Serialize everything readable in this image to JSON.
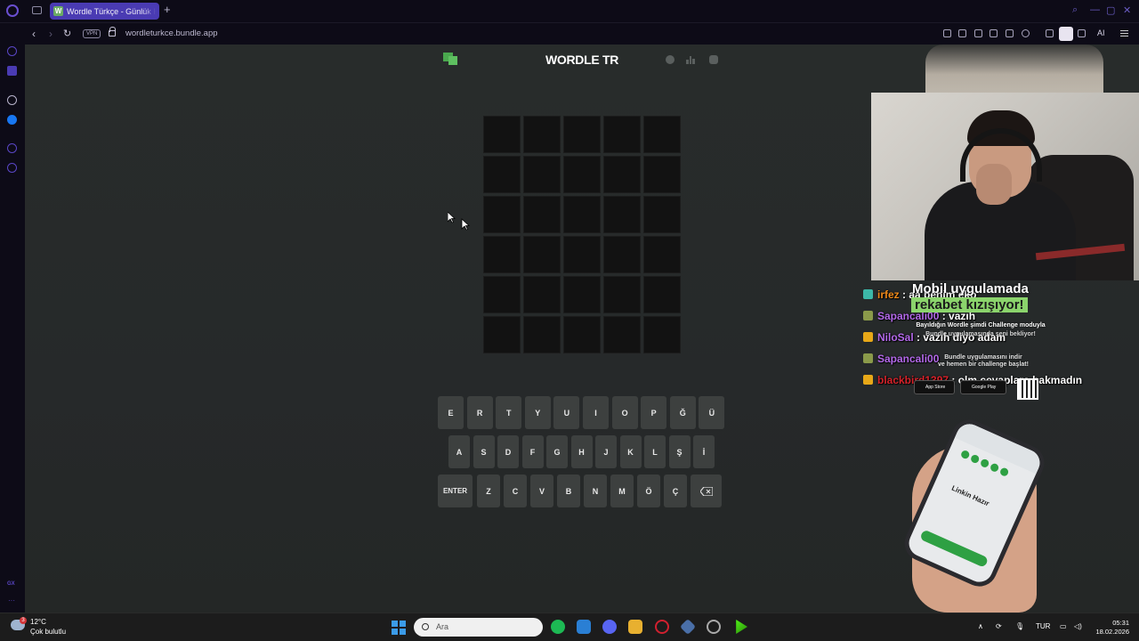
{
  "browser": {
    "tab_title": "Wordle Türkçe - Günlük Ke",
    "tab_favicon": "W",
    "url": "wordleturkce.bundle.app",
    "vpn_label": "VPN",
    "ai_label": "AI",
    "accent_color": "#4a3bb3"
  },
  "sidebar": {
    "gx_label": "GX",
    "more_label": "···"
  },
  "game": {
    "title": "WORDLE TR",
    "rows": 6,
    "cols": 5,
    "keyboard": {
      "row1": [
        "E",
        "R",
        "T",
        "Y",
        "U",
        "I",
        "O",
        "P",
        "Ğ",
        "Ü"
      ],
      "row2": [
        "A",
        "S",
        "D",
        "F",
        "G",
        "H",
        "J",
        "K",
        "L",
        "Ş",
        "İ"
      ],
      "row3": [
        "ENTER",
        "Z",
        "C",
        "V",
        "B",
        "N",
        "M",
        "Ö",
        "Ç",
        "backspace-icon"
      ]
    }
  },
  "stream": {
    "chat": [
      {
        "user": "irfez",
        "msg": ": aa benim eko",
        "user_color": "#f08a1a",
        "badge_color": "#3cb8a8"
      },
      {
        "user": "Sapancali00",
        "msg": ": vazıh",
        "user_color": "#b268e8",
        "badge_color": "#8a9a4a"
      },
      {
        "user": "NiloSal",
        "msg": ": vazıh diyo adam",
        "user_color": "#b268e8",
        "badge_color": "#e8a818"
      },
      {
        "user": "Sapancali00",
        "msg": "",
        "user_color": "#b268e8",
        "badge_color": "#8a9a4a"
      },
      {
        "user": "blackbird1397",
        "msg": ": olm cevaplara bakmadın",
        "user_color": "#d4222a",
        "badge_color": "#e8a818"
      }
    ],
    "ad": {
      "title": "Mobil uygulamada",
      "highlight": "rekabet kızışıyor!",
      "line1": "Bayıldığın Wordle şimdi Challenge moduyla",
      "line2": "Bundle uygulamasında seni bekliyor!",
      "line3": "Bundle uygulamasını indir",
      "line4": "ve hemen bir challenge başlat!",
      "app_store": "App Store",
      "google_play": "Google Play",
      "phone_text": "Linkin Hazır"
    }
  },
  "taskbar": {
    "temperature": "12°C",
    "weather": "Çok bulutlu",
    "weather_badge": "3",
    "search_placeholder": "Ara",
    "language": "TUR",
    "time": "05:31",
    "date": "18.02.2026"
  }
}
